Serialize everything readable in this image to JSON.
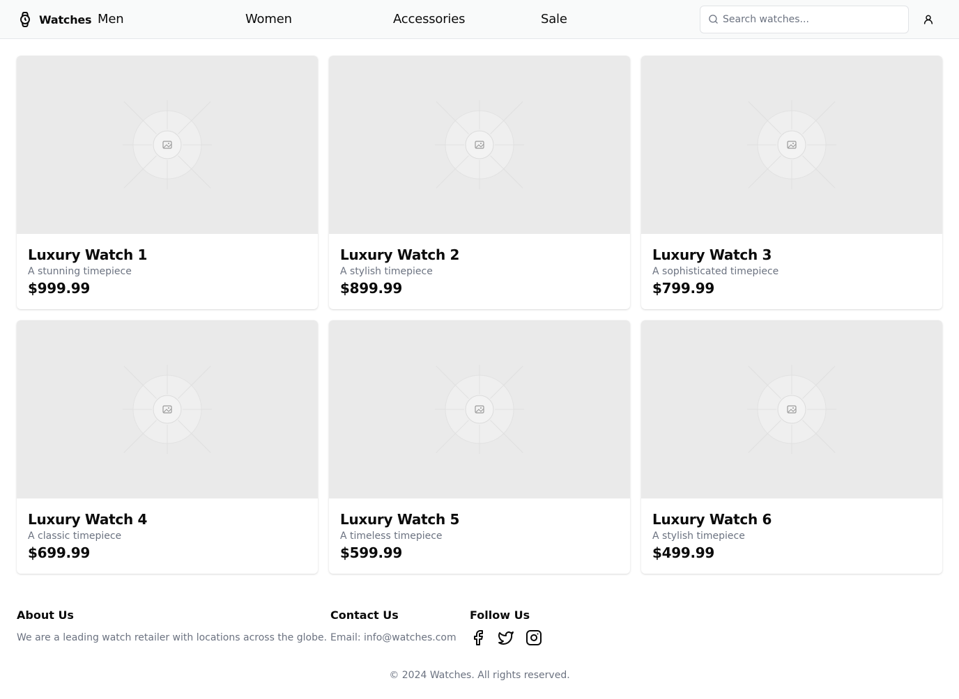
{
  "header": {
    "brand": "Watches",
    "nav": {
      "men": "Men",
      "women": "Women",
      "accessories": "Accessories",
      "sale": "Sale"
    },
    "search": {
      "placeholder": "Search watches...",
      "value": ""
    }
  },
  "products": [
    {
      "title": "Luxury Watch 1",
      "description": "A stunning timepiece",
      "price": "$999.99"
    },
    {
      "title": "Luxury Watch 2",
      "description": "A stylish timepiece",
      "price": "$899.99"
    },
    {
      "title": "Luxury Watch 3",
      "description": "A sophisticated timepiece",
      "price": "$799.99"
    },
    {
      "title": "Luxury Watch 4",
      "description": "A classic timepiece",
      "price": "$699.99"
    },
    {
      "title": "Luxury Watch 5",
      "description": "A timeless timepiece",
      "price": "$599.99"
    },
    {
      "title": "Luxury Watch 6",
      "description": "A stylish timepiece",
      "price": "$499.99"
    }
  ],
  "footer": {
    "about": {
      "heading": "About Us",
      "text": "We are a leading watch retailer with locations across the globe."
    },
    "contact": {
      "heading": "Contact Us",
      "text": "Email: info@watches.com"
    },
    "follow": {
      "heading": "Follow Us",
      "icons": [
        "facebook-icon",
        "twitter-icon",
        "instagram-icon"
      ]
    },
    "copyright": "© 2024 Watches. All rights reserved."
  },
  "colors": {
    "header_bg": "#f9fafa",
    "placeholder_bg": "#eaeaea",
    "muted_text": "#6b7280",
    "text": "#0b0b0b"
  }
}
